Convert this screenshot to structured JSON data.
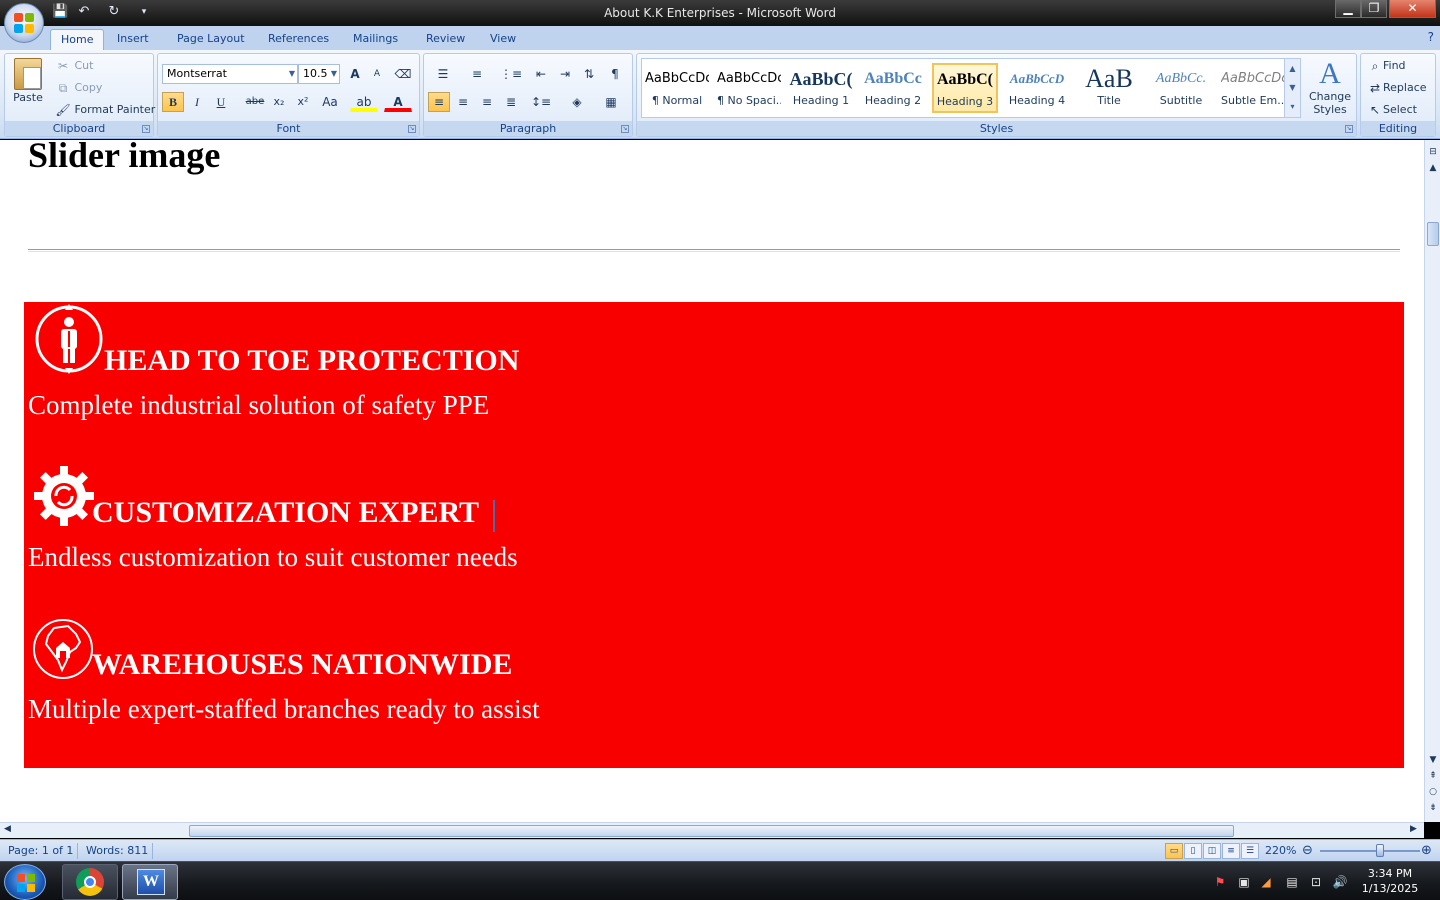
{
  "window": {
    "title": "About K.K Enterprises - Microsoft Word",
    "minimize": "▁",
    "maximize": "❐",
    "close": "✕"
  },
  "tabs": [
    "Home",
    "Insert",
    "Page Layout",
    "References",
    "Mailings",
    "Review",
    "View"
  ],
  "clipboard": {
    "label": "Clipboard",
    "paste": "Paste",
    "cut": "Cut",
    "copy": "Copy",
    "format_painter": "Format Painter"
  },
  "font": {
    "label": "Font",
    "family": "Montserrat",
    "size": "10.5",
    "bold": "B",
    "italic": "I",
    "underline": "U",
    "strike": "abe",
    "subscript": "x₂",
    "superscript": "x²",
    "change_case": "Aa",
    "grow": "A",
    "shrink": "A",
    "highlight": "ab",
    "color": "A"
  },
  "paragraph": {
    "label": "Paragraph"
  },
  "styles": {
    "label": "Styles",
    "items": [
      {
        "preview": "AaBbCcDc",
        "name": "¶ Normal"
      },
      {
        "preview": "AaBbCcDc",
        "name": "¶ No Spaci..."
      },
      {
        "preview": "AaBbC(",
        "name": "Heading 1"
      },
      {
        "preview": "AaBbCc",
        "name": "Heading 2"
      },
      {
        "preview": "AaBbC(",
        "name": "Heading 3"
      },
      {
        "preview": "AaBbCcD",
        "name": "Heading 4"
      },
      {
        "preview": "AaB",
        "name": "Title"
      },
      {
        "preview": "AaBbCc.",
        "name": "Subtitle"
      },
      {
        "preview": "AaBbCcDc",
        "name": "Subtle Em..."
      }
    ],
    "selected_index": 4,
    "change_styles": "Change Styles"
  },
  "editing": {
    "label": "Editing",
    "find": "Find",
    "replace": "Replace",
    "select": "Select"
  },
  "document": {
    "heading": "Slider image",
    "features": [
      {
        "title": "HEAD TO TOE PROTECTION",
        "desc": "Complete industrial solution of safety PPE"
      },
      {
        "title": "CUSTOMIZATION EXPERT",
        "desc": "Endless customization to suit customer needs"
      },
      {
        "title": "WAREHOUSES NATIONWIDE",
        "desc": "Multiple expert-staffed branches ready to assist"
      }
    ]
  },
  "status": {
    "page": "Page: 1 of 1",
    "words": "Words: 811",
    "zoom": "220%"
  },
  "taskbar": {
    "time": "3:34 PM",
    "date": "1/13/2025"
  },
  "colors": {
    "banner": "#f80000",
    "ribbon_accent": "#15428b"
  }
}
